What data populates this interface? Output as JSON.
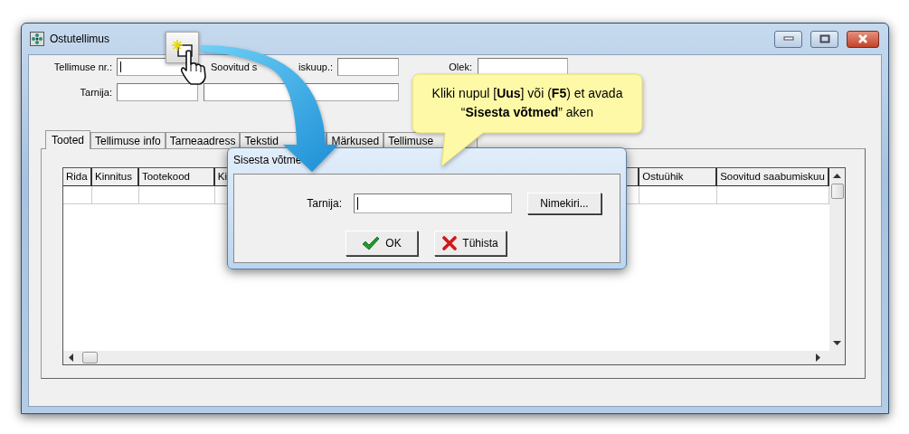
{
  "window": {
    "title": "Ostutellimus"
  },
  "header_form": {
    "order_number_label": "Tellimuse nr.:",
    "order_number_focused": true,
    "desired_date_label_start": "Soovitud s",
    "desired_date_label_end": "iskuup.:",
    "status_label": "Olek:",
    "supplier_label": "Tarnija:"
  },
  "tabs": [
    {
      "label": "Tooted",
      "selected": true
    },
    {
      "label": "Tellimuse info",
      "selected": false
    },
    {
      "label": "Tarneaadress",
      "selected": false
    },
    {
      "label": "Tekstid",
      "selected": false
    },
    {
      "label": "Märkused",
      "selected": false
    },
    {
      "label": "Tellimuse",
      "selected": false
    }
  ],
  "table": {
    "columns": [
      "Rida",
      "Kinnitus",
      "Tootekood",
      "Ki",
      "Ostuühik",
      "Soovitud saabumiskuu"
    ]
  },
  "dialog": {
    "title": "Sisesta võtme",
    "field_label": "Tarnija:",
    "field_focused": true,
    "buttons": [
      {
        "kind": "list",
        "label": "Nimekiri..."
      },
      {
        "kind": "ok",
        "label": "OK"
      },
      {
        "kind": "cancel",
        "label": "Tühista"
      }
    ]
  },
  "callout": {
    "text": "Kliki nupul [**Uus**] või (**F5**) et avada  “**Sisesta võtmed**” aken"
  }
}
